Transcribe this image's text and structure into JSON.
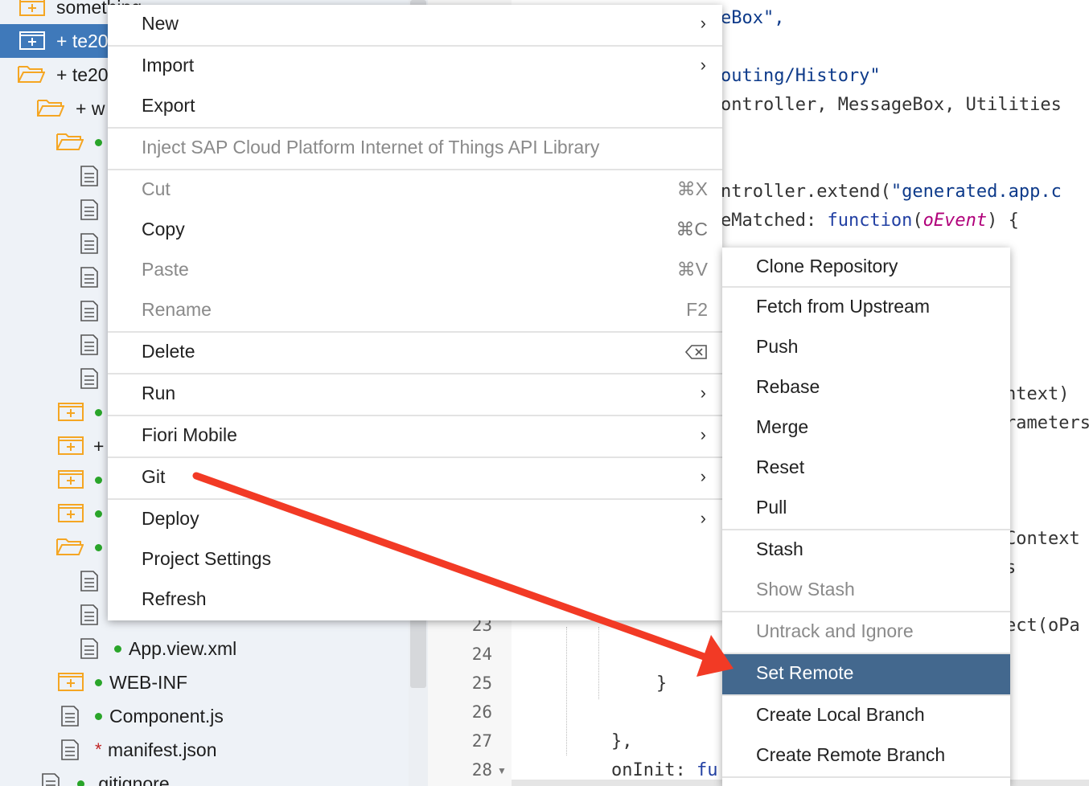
{
  "tree": {
    "rows": [
      {
        "label": "something"
      },
      {
        "label": "+ te20"
      },
      {
        "label": "+ te20"
      },
      {
        "label": "+ w"
      },
      {
        "label": "+"
      },
      {
        "label": "App.view.xml"
      },
      {
        "label": "WEB-INF"
      },
      {
        "label": "Component.js"
      },
      {
        "label": "manifest.json"
      },
      {
        "label": ".gitignore"
      }
    ]
  },
  "editor": {
    "line_numbers": [
      "23",
      "24",
      "25",
      "26",
      "27",
      "28"
    ],
    "code_fragments": {
      "f1": "eBox\",",
      "f2": "outing/History\"",
      "f3": "ontroller, MessageBox, Utilities",
      "f4a": "ntroller.extend(",
      "f4b": "\"generated.app.c",
      "f5a": "eMatched: ",
      "f5b": "function",
      "f5c": "(",
      "f5d": "oEvent",
      "f5e": ") {",
      "f6": "ntext)",
      "f7": "rameters",
      "f8": "Context",
      "f9": "s",
      "f10": "ect(oPa",
      "f11": "}",
      "f12": "},",
      "f13a": "onInit: ",
      "f13b": "fu"
    }
  },
  "context_menu": {
    "new": "New",
    "import": "Import",
    "export": "Export",
    "inject": "Inject SAP Cloud Platform Internet of Things API Library",
    "cut": "Cut",
    "cut_sc": "⌘X",
    "copy": "Copy",
    "copy_sc": "⌘C",
    "paste": "Paste",
    "paste_sc": "⌘V",
    "rename": "Rename",
    "rename_sc": "F2",
    "delete": "Delete",
    "run": "Run",
    "fiori": "Fiori Mobile",
    "git": "Git",
    "deploy": "Deploy",
    "settings": "Project Settings",
    "refresh": "Refresh",
    "submenu_arrow": "›"
  },
  "git_submenu": {
    "clone": "Clone Repository",
    "fetch": "Fetch from Upstream",
    "push": "Push",
    "rebase": "Rebase",
    "merge": "Merge",
    "reset": "Reset",
    "pull": "Pull",
    "stash": "Stash",
    "show_stash": "Show Stash",
    "untrack": "Untrack and Ignore",
    "set_remote": "Set Remote",
    "create_local": "Create Local Branch",
    "create_remote": "Create Remote Branch"
  },
  "colors": {
    "selection": "#3f79ba",
    "highlight": "#43688e",
    "folder": "#f5a623",
    "status_dot": "#2aa52a",
    "annotation_arrow": "#f23a25"
  }
}
